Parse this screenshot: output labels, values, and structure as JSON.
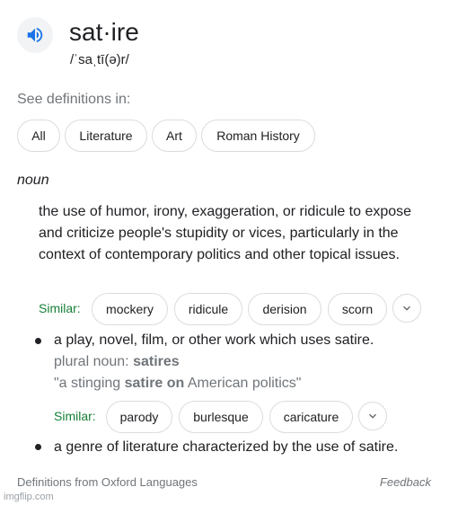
{
  "header": {
    "word": "sat·ire",
    "phonetic": "/ˈsaˌtī(ə)r/",
    "speaker_icon": "volume-up-icon"
  },
  "see_definitions": {
    "label": "See definitions in:",
    "chips": [
      "All",
      "Literature",
      "Art",
      "Roman History"
    ]
  },
  "entry": {
    "part_of_speech": "noun",
    "definition_1": "the use of humor, irony, exaggeration, or ridicule to expose and criticize people's stupidity or vices, particularly in the context of contemporary politics and other topical issues.",
    "similar_1": {
      "label": "Similar:",
      "words": [
        "mockery",
        "ridicule",
        "derision",
        "scorn"
      ]
    },
    "definition_2": "a play, novel, film, or other work which uses satire.",
    "plural_label": "plural noun:",
    "plural_value": "satires",
    "example_prefix": "\"a stinging ",
    "example_bold": "satire on",
    "example_suffix": " American politics\"",
    "similar_2": {
      "label": "Similar:",
      "words": [
        "parody",
        "burlesque",
        "caricature"
      ]
    },
    "definition_3": "a genre of literature characterized by the use of satire."
  },
  "footer": {
    "source": "Definitions from Oxford Languages",
    "feedback": "Feedback"
  },
  "watermark": "imgflip.com",
  "colors": {
    "accent_blue": "#1a73e8",
    "similar_green": "#188038",
    "muted_gray": "#70757a"
  }
}
